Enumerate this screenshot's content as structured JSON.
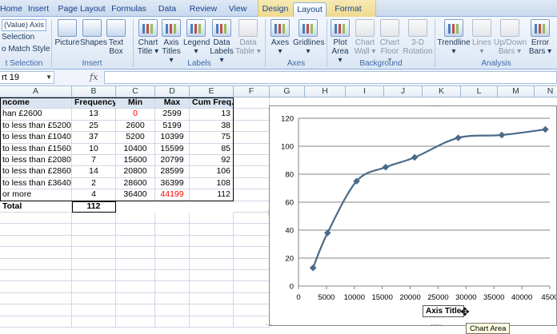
{
  "tabs": [
    "Home",
    "Insert",
    "Page Layout",
    "Formulas",
    "Data",
    "Review",
    "View",
    "Design",
    "Layout",
    "Format"
  ],
  "active_tab": "Layout",
  "ribbon": {
    "current_selection": {
      "combo_value": "(Value) Axis Tr",
      "format_selection": "Selection",
      "reset_label": "o Match Style",
      "group_label": "t Selection"
    },
    "insert": {
      "picture": "Picture",
      "shapes": "Shapes",
      "text_box_1": "Text",
      "text_box_2": "Box",
      "group_label": "Insert"
    },
    "labels": {
      "chart_title_1": "Chart",
      "chart_title_2": "Title ▾",
      "axis_titles_1": "Axis",
      "axis_titles_2": "Titles ▾",
      "legend_1": "Legend",
      "legend_2": "▾",
      "data_labels_1": "Data",
      "data_labels_2": "Labels ▾",
      "data_table_1": "Data",
      "data_table_2": "Table ▾",
      "group_label": "Labels"
    },
    "axes": {
      "axes_1": "Axes",
      "axes_2": "▾",
      "gridlines_1": "Gridlines",
      "gridlines_2": "▾",
      "group_label": "Axes"
    },
    "background": {
      "plot_area_1": "Plot",
      "plot_area_2": "Area ▾",
      "chart_wall_1": "Chart",
      "chart_wall_2": "Wall ▾",
      "chart_floor_1": "Chart",
      "chart_floor_2": "Floor ▾",
      "rotation_1": "3-D",
      "rotation_2": "Rotation",
      "group_label": "Background"
    },
    "analysis": {
      "trendline_1": "Trendline",
      "trendline_2": "▾",
      "lines_1": "Lines",
      "lines_2": "▾",
      "updown_1": "Up/Down",
      "updown_2": "Bars ▾",
      "error_1": "Error",
      "error_2": "Bars ▾",
      "group_label": "Analysis"
    }
  },
  "formula_bar": {
    "name_box": "rt 19",
    "fx": "fx",
    "value": ""
  },
  "columns": [
    "A",
    "B",
    "C",
    "D",
    "E",
    "F",
    "G",
    "H",
    "I",
    "J",
    "K",
    "L",
    "M",
    "N"
  ],
  "table": {
    "headers": [
      "ncome",
      "Frequency",
      "Min",
      "Max",
      "Cum Freq."
    ],
    "rows": [
      {
        "label": "han £2600",
        "freq": "13",
        "min": "0",
        "max": "2599",
        "cum": "13"
      },
      {
        "label": "to less than £5200",
        "freq": "25",
        "min": "2600",
        "max": "5199",
        "cum": "38"
      },
      {
        "label": "to less than £10400",
        "freq": "37",
        "min": "5200",
        "max": "10399",
        "cum": "75"
      },
      {
        "label": "to less than £15600",
        "freq": "10",
        "min": "10400",
        "max": "15599",
        "cum": "85"
      },
      {
        "label": "to less than £20800",
        "freq": "7",
        "min": "15600",
        "max": "20799",
        "cum": "92"
      },
      {
        "label": "to less than £28600",
        "freq": "14",
        "min": "20800",
        "max": "28599",
        "cum": "106"
      },
      {
        "label": "to less than £36400",
        "freq": "2",
        "min": "28600",
        "max": "36399",
        "cum": "108"
      },
      {
        "label": "or more",
        "freq": "4",
        "min": "36400",
        "max": "44199",
        "cum": "112"
      }
    ],
    "total_label": "Total",
    "total_value": "112"
  },
  "chart": {
    "axis_title": "Axis Title",
    "tooltip": "Chart Area"
  },
  "chart_data": {
    "type": "line",
    "x": [
      2599,
      5199,
      10399,
      15599,
      20799,
      28599,
      36399,
      44199
    ],
    "values": [
      13,
      38,
      75,
      85,
      92,
      106,
      108,
      112
    ],
    "xlim": [
      0,
      45000
    ],
    "ylim": [
      0,
      120
    ],
    "x_ticks": [
      "0",
      "5000",
      "10000",
      "15000",
      "20000",
      "25000",
      "30000",
      "35000",
      "40000",
      "4500"
    ],
    "y_ticks": [
      "0",
      "20",
      "40",
      "60",
      "80",
      "100",
      "120"
    ],
    "smooth": true,
    "grid": true,
    "xlabel": "Axis Title",
    "colors": {
      "line": "#4a6b8a",
      "marker": "#4a6b8a"
    }
  }
}
